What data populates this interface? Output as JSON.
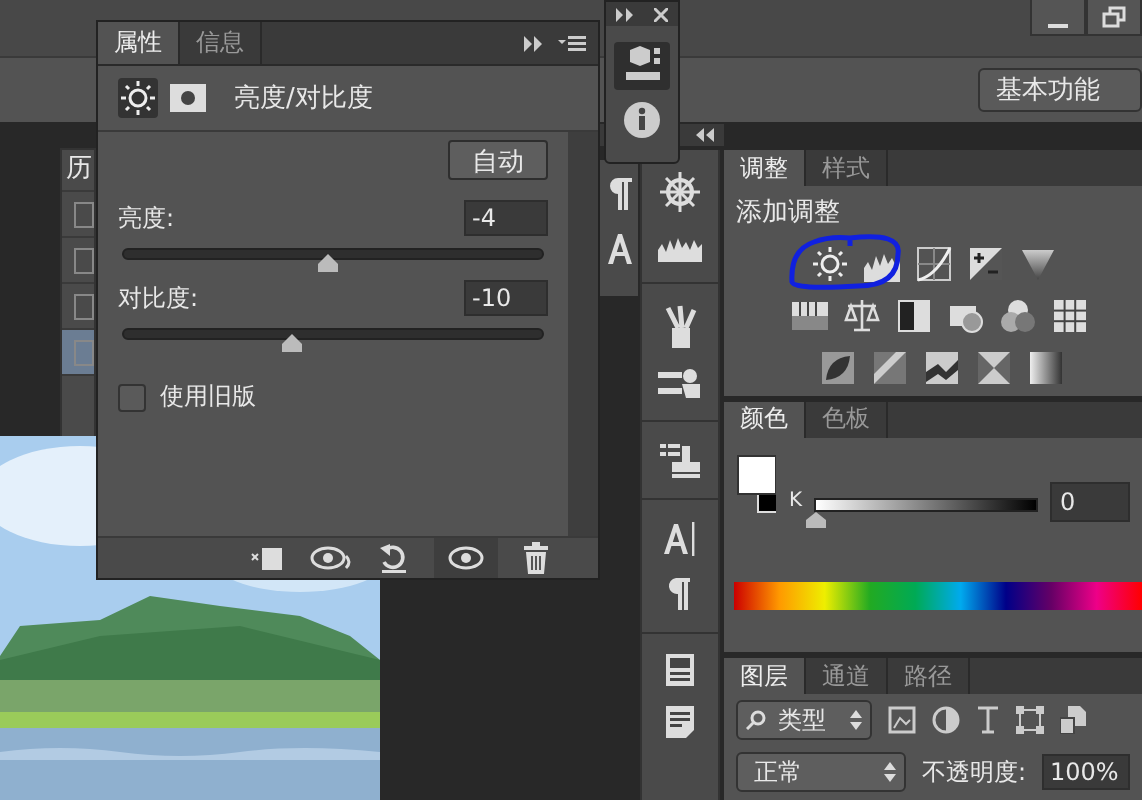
{
  "workspace": {
    "label": "基本功能"
  },
  "history_panel": {
    "tab": "历",
    "rows": [
      {
        "checked": false,
        "selected": false
      },
      {
        "checked": false,
        "selected": false
      },
      {
        "checked": false,
        "selected": false
      },
      {
        "checked": false,
        "selected": true
      }
    ]
  },
  "properties_panel": {
    "tabs": [
      {
        "label": "属性",
        "selected": true
      },
      {
        "label": "信息",
        "selected": false
      }
    ],
    "title": "亮度/对比度",
    "auto_button": "自动",
    "sliders": [
      {
        "label": "亮度:",
        "value": "-4",
        "level": 0.49
      },
      {
        "label": "对比度:",
        "value": "-10",
        "level": 0.4
      }
    ],
    "legacy": {
      "label": "使用旧版",
      "checked": false
    }
  },
  "adjustments_panel": {
    "tabs": [
      {
        "label": "调整",
        "selected": true
      },
      {
        "label": "样式",
        "selected": false
      }
    ],
    "heading": "添加调整"
  },
  "color_panel": {
    "tabs": [
      {
        "label": "颜色",
        "selected": true
      },
      {
        "label": "色板",
        "selected": false
      }
    ],
    "channel": "K",
    "level": 0,
    "value": "0"
  },
  "layers_panel": {
    "tabs": [
      {
        "label": "图层",
        "selected": true
      },
      {
        "label": "通道",
        "selected": false
      },
      {
        "label": "路径",
        "selected": false
      }
    ],
    "filter": "类型",
    "blend_mode": "正常",
    "opacity_label": "不透明度:",
    "opacity": "100%"
  }
}
